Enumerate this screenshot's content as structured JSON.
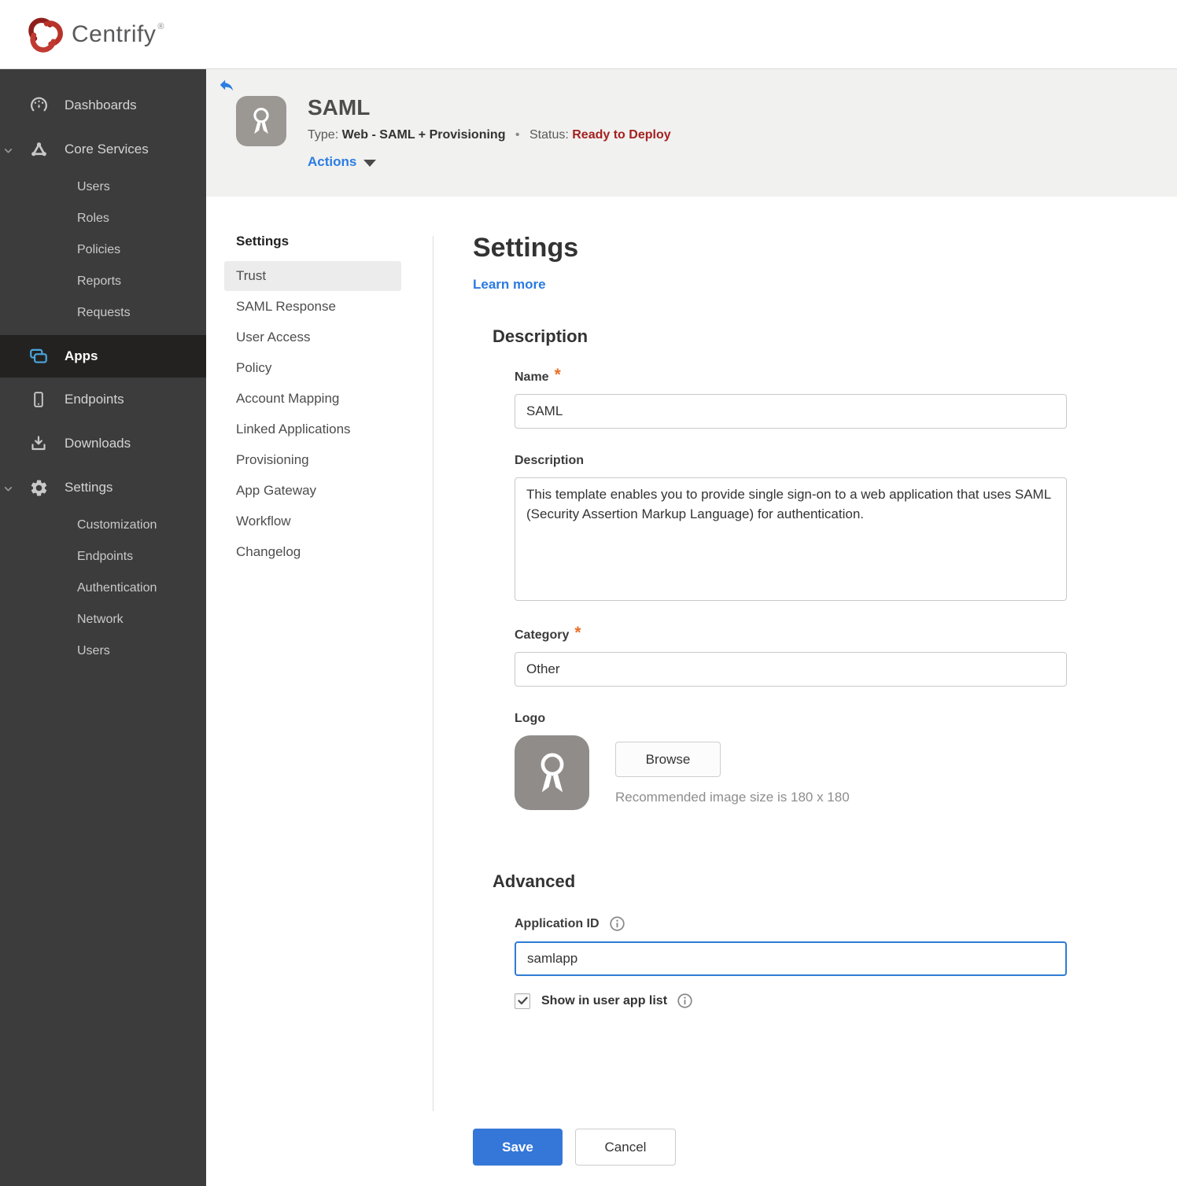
{
  "brand": {
    "name": "Centrify",
    "registered_mark": "®",
    "logo_red": "#b93229",
    "logo_dark_red": "#8f1f1c"
  },
  "sidebar": {
    "dashboards": "Dashboards",
    "core_services": "Core Services",
    "core_children": [
      "Users",
      "Roles",
      "Policies",
      "Reports",
      "Requests"
    ],
    "apps": "Apps",
    "endpoints": "Endpoints",
    "downloads": "Downloads",
    "settings": "Settings",
    "settings_children": [
      "Customization",
      "Endpoints",
      "Authentication",
      "Network",
      "Users"
    ],
    "selected_item": "Apps",
    "apps_icon_blue": "#4ba6e0"
  },
  "app_header": {
    "title": "SAML",
    "type_label": "Type:",
    "type_value": "Web - SAML + Provisioning",
    "separator": "•",
    "status_label": "Status:",
    "status_value": "Ready to Deploy",
    "status_color": "#a32220",
    "actions_label": "Actions"
  },
  "subnav": {
    "header": "Settings",
    "items": [
      "Trust",
      "SAML Response",
      "User Access",
      "Policy",
      "Account Mapping",
      "Linked Applications",
      "Provisioning",
      "App Gateway",
      "Workflow",
      "Changelog"
    ],
    "selected": "Trust"
  },
  "main": {
    "title": "Settings",
    "learn_more": "Learn more",
    "required_marker": "*",
    "description_section": {
      "heading": "Description",
      "name_label": "Name",
      "name_value": "SAML",
      "description_label": "Description",
      "description_value": "This template enables you to provide single sign-on to a web application that uses SAML (Security Assertion Markup Language) for authentication.",
      "category_label": "Category",
      "category_value": "Other",
      "logo_label": "Logo",
      "browse_button": "Browse",
      "logo_hint": "Recommended image size is 180 x 180"
    },
    "advanced_section": {
      "heading": "Advanced",
      "app_id_label": "Application ID",
      "app_id_value": "samlapp",
      "show_in_list_label": "Show in user app list",
      "show_in_list_checked": true
    },
    "save_button": "Save",
    "cancel_button": "Cancel",
    "accent_blue": "#3577d8"
  }
}
